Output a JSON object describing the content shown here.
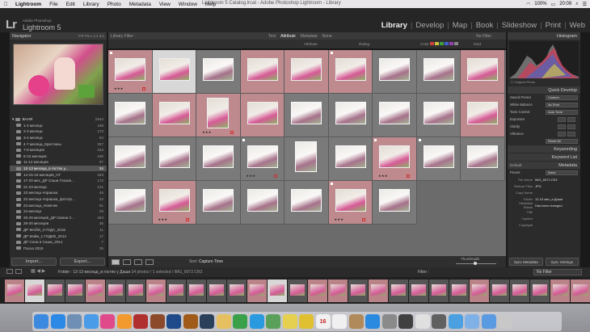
{
  "menubar": {
    "app_name": "Lightroom",
    "items": [
      "File",
      "Edit",
      "Library",
      "Photo",
      "Metadata",
      "View",
      "Window",
      "Help"
    ],
    "window_title": "Lightroom 5 Catalog.lrcat - Adobe Photoshop Lightroom - Library",
    "battery": "100%",
    "clock": "20:09"
  },
  "identity": {
    "logo": "Lr",
    "subtitle": "Adobe Photoshop",
    "product": "Lightroom 5"
  },
  "modules": [
    "Library",
    "Develop",
    "Map",
    "Book",
    "Slideshow",
    "Print",
    "Web"
  ],
  "active_module": "Library",
  "navigator": {
    "title": "Navigator",
    "zoom_options": "FIT  FILL  1:1  3:1"
  },
  "folders": {
    "root": {
      "name": "ВАНЯ",
      "count": "2944"
    },
    "items": [
      {
        "name": "1-2 месяца",
        "count": "198"
      },
      {
        "name": "2-3 месяца",
        "count": "170"
      },
      {
        "name": "3-4 месяца",
        "count": "64"
      },
      {
        "name": "4-7 месяца_Крестины",
        "count": "267"
      },
      {
        "name": "7-8 месяцев",
        "count": "154"
      },
      {
        "name": "8-10 месяцев",
        "count": "190"
      },
      {
        "name": "11-12 месяцев",
        "count": "97"
      },
      {
        "name": "12-13 месяца_в гостях у...",
        "count": "34"
      },
      {
        "name": "14-15-16 месяцев_НГ",
        "count": "323"
      },
      {
        "name": "17-20 мес_ДР Саши Глазов...",
        "count": "172"
      },
      {
        "name": "21-23 месяца",
        "count": "121"
      },
      {
        "name": "22 месяца Апрашка",
        "count": "45"
      },
      {
        "name": "22 месяца Апрашка_фотогр...",
        "count": "23"
      },
      {
        "name": "23 месяца_Новочек",
        "count": "91"
      },
      {
        "name": "24 месяца",
        "count": "29"
      },
      {
        "name": "26-28 месяцев_ДР Смени 2...",
        "count": "463"
      },
      {
        "name": "29-30 месяцев",
        "count": "35"
      },
      {
        "name": "ДР МАЙИ_3 ГОДА_2015",
        "count": "11"
      },
      {
        "name": "ДР Майи_1 ГОДИК_2014",
        "count": "17"
      },
      {
        "name": "ДР Сони и Саши_2014",
        "count": "7"
      },
      {
        "name": "Пасха 2015",
        "count": "25"
      }
    ],
    "selected_index": 7
  },
  "left_buttons": {
    "import": "Import...",
    "export": "Export..."
  },
  "library_filter": {
    "title": "Library Filter :",
    "tabs": [
      "Text",
      "Attribute",
      "Metadata",
      "None"
    ],
    "active_tab": "Attribute",
    "preset": "No Filter"
  },
  "attribute_bar": {
    "attribute_label": "Attribute",
    "flag_label": "Flag",
    "rating_label": "Rating",
    "color_label": "Color",
    "kind_label": "Kind",
    "colors": [
      "#d04040",
      "#d0c040",
      "#40a040",
      "#4060d0",
      "#9040b0",
      "#888888"
    ]
  },
  "grid": {
    "rows": [
      [
        "tint pick",
        "sel",
        "dim",
        "tint",
        "tint",
        "tint pick",
        "dim",
        "dim",
        "tint"
      ],
      [
        "dim",
        "tint",
        "tint portrait",
        "tint",
        "dim",
        "dim",
        "dim",
        "dim",
        "tint"
      ],
      [
        "dim",
        "dim",
        "dim",
        "dim pick",
        "dim portrait",
        "dim",
        "tint pick",
        "dim pick",
        "dim"
      ],
      [
        "dim",
        "tint",
        "dim",
        "dim",
        "dim",
        "tint pick",
        "dim"
      ]
    ],
    "ratings": {
      "0-0": "★★★",
      "1-2": "★★★",
      "2-3": "★★★",
      "2-6": "★★★",
      "3-1": "★★★",
      "3-5": "★★★"
    }
  },
  "toolbar": {
    "sort_label": "Sort:",
    "sort_value": "Capture Time",
    "thumbnails_label": "Thumbnails"
  },
  "right_panel": {
    "histogram": "Histogram",
    "original_photo": "Original Photo",
    "quick_develop": "Quick Develop",
    "saved_preset_label": "Saved Preset",
    "saved_preset_value": "Custom",
    "white_balance_label": "White Balance",
    "white_balance_value": "As Shot",
    "tone_control_label": "Tone Control",
    "tone_control_value": "Auto Tone",
    "exposure_label": "Exposure",
    "clarity_label": "Clarity",
    "vibrance_label": "Vibrance",
    "reset_label": "Reset All",
    "keywording": "Keywording",
    "keyword_list": "Keyword List",
    "metadata": "Metadata",
    "metadata_preset_label": "Preset",
    "metadata_preset_value": "None",
    "metadata_default": "Default",
    "meta_rows": [
      {
        "k": "File Name",
        "v": "IMG_6972.CR2"
      },
      {
        "k": "Sidecar Files",
        "v": "JPG"
      },
      {
        "k": "Copy Name",
        "v": ""
      },
      {
        "k": "Folder",
        "v": "12-13 мес_в Даши"
      },
      {
        "k": "Metadata Status",
        "v": "Has been changed"
      },
      {
        "k": "Title",
        "v": ""
      },
      {
        "k": "Caption",
        "v": ""
      },
      {
        "k": "Copyright",
        "v": ""
      }
    ],
    "sync_metadata": "Sync Metadata",
    "sync_settings": "Sync Settings"
  },
  "filmstrip_bar": {
    "path": "Folder : 12-13 месяца_в гостях у Даши",
    "count": "34 photos / 1 selected / IMG_6972.CR2",
    "filter_label": "Filter :",
    "filter_value": "No Filter"
  },
  "filmstrip": [
    "tint",
    "sel",
    "",
    "",
    "tint",
    "",
    "",
    "tint",
    "",
    "",
    "",
    "",
    "tint",
    "sel",
    "",
    "tint",
    "tint",
    "",
    "tint",
    "",
    "",
    "",
    "",
    "tint",
    "",
    "",
    "",
    "tint",
    "tint"
  ],
  "dock": [
    {
      "name": "Finder",
      "color": "#3c8ae0"
    },
    {
      "name": "Safari",
      "color": "#2d89e6"
    },
    {
      "name": "Preview",
      "color": "#6f8fb5"
    },
    {
      "name": "Mail",
      "color": "#4a9be8"
    },
    {
      "name": "iTunes",
      "color": "#e04a8a"
    },
    {
      "name": "iBooks",
      "color": "#f29a2e"
    },
    {
      "name": "Photo Booth",
      "color": "#b03030"
    },
    {
      "name": "Bridge",
      "color": "#8c4a2a"
    },
    {
      "name": "Photoshop",
      "color": "#1f4a8a"
    },
    {
      "name": "Bridge CC",
      "color": "#a05a1a"
    },
    {
      "name": "Lightroom",
      "color": "#2a3f5a"
    },
    {
      "name": "Photos",
      "color": "#e6c060"
    },
    {
      "name": "FaceTime",
      "color": "#3aa04a"
    },
    {
      "name": "Skype",
      "color": "#2a9ae0"
    },
    {
      "name": "Maps",
      "color": "#5aa05a"
    },
    {
      "name": "Notes",
      "color": "#e6d050"
    },
    {
      "name": "Stickies",
      "color": "#e0c030"
    },
    {
      "name": "Calendar",
      "color": "#f0f0f0"
    },
    {
      "name": "Reminders",
      "color": "#f0f0f0"
    },
    {
      "name": "Contacts",
      "color": "#b08a5a"
    },
    {
      "name": "App Store",
      "color": "#2a8ae0"
    },
    {
      "name": "System Preferences",
      "color": "#8a8a8a"
    },
    {
      "name": "Activity Monitor",
      "color": "#404040"
    },
    {
      "name": "Chrome",
      "color": "#e0e0e0"
    },
    {
      "name": "Calculator",
      "color": "#606060"
    },
    {
      "name": "Downloads",
      "color": "#4aa0e0"
    },
    {
      "name": "Documents",
      "color": "#7fb0e6"
    },
    {
      "name": "Folder",
      "color": "#5a9ae0"
    },
    {
      "name": "Trash",
      "color": "#c8c8c8"
    }
  ],
  "dock_calendar_day": "16"
}
